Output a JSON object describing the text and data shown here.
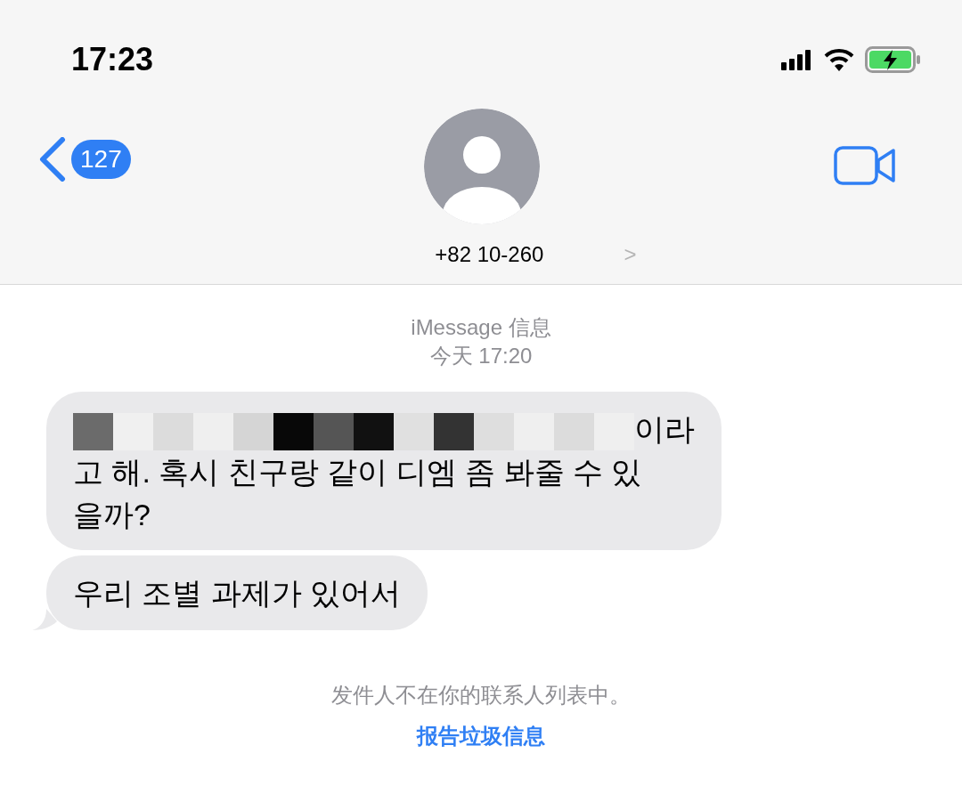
{
  "status_bar": {
    "time": "17:23"
  },
  "header": {
    "back_badge": "127",
    "contact": "+82 10-260",
    "contact_chevron": ">"
  },
  "thread_info": {
    "service": "iMessage 信息",
    "timestamp": "今天 17:20"
  },
  "messages": [
    {
      "kind": "redacted",
      "first_line_tail": "이라",
      "text": "고 해. 혹시 친구랑 같이 디엠 좀 봐줄 수 있을까?",
      "tail": false
    },
    {
      "kind": "plain",
      "text": "우리 조별 과제가 있어서",
      "tail": true
    }
  ],
  "footer": {
    "notice": "发件人不在你的联系人列表中。",
    "report_link": "报告垃圾信息"
  }
}
